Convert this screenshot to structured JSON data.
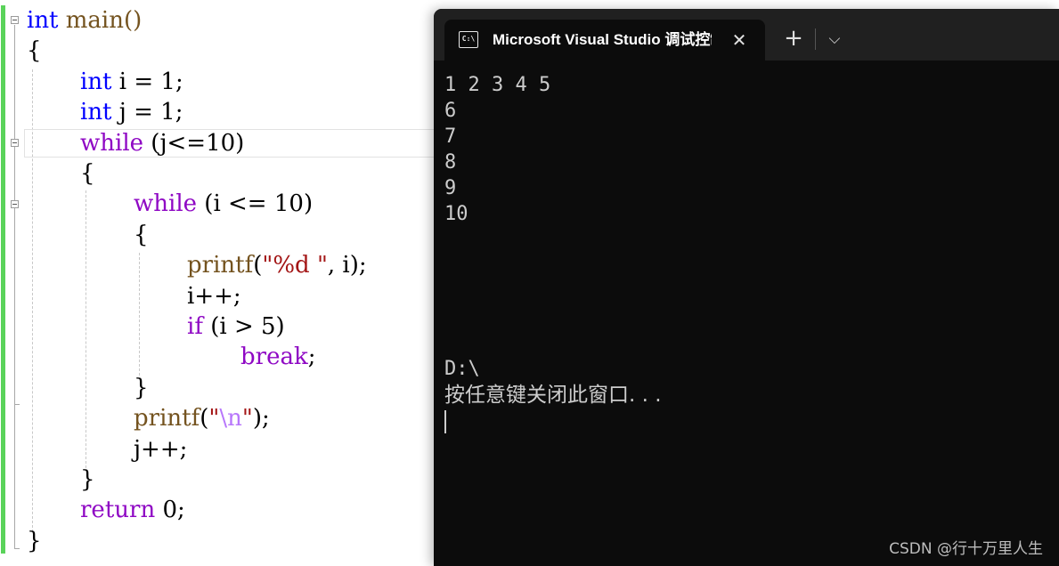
{
  "editor": {
    "lines": [
      {
        "indent": 0,
        "tokens": [
          {
            "t": "int",
            "c": "kw"
          },
          {
            "t": " main()",
            "c": "fn"
          }
        ]
      },
      {
        "indent": 0,
        "tokens": [
          {
            "t": "{",
            "c": ""
          }
        ]
      },
      {
        "indent": 1,
        "tokens": [
          {
            "t": "int",
            "c": "kw"
          },
          {
            "t": " i = 1;",
            "c": ""
          }
        ]
      },
      {
        "indent": 1,
        "tokens": [
          {
            "t": "int",
            "c": "kw"
          },
          {
            "t": " j = 1;",
            "c": ""
          }
        ]
      },
      {
        "indent": 1,
        "tokens": [
          {
            "t": "while",
            "c": "kw2"
          },
          {
            "t": " (j<=10)",
            "c": ""
          }
        ]
      },
      {
        "indent": 1,
        "tokens": [
          {
            "t": "{",
            "c": ""
          }
        ]
      },
      {
        "indent": 2,
        "tokens": [
          {
            "t": "while",
            "c": "kw2"
          },
          {
            "t": " (i <= 10)",
            "c": ""
          }
        ]
      },
      {
        "indent": 2,
        "tokens": [
          {
            "t": "{",
            "c": ""
          }
        ]
      },
      {
        "indent": 3,
        "tokens": [
          {
            "t": "printf",
            "c": "fn"
          },
          {
            "t": "(",
            "c": ""
          },
          {
            "t": "\"%d \"",
            "c": "str"
          },
          {
            "t": ", i);",
            "c": ""
          }
        ]
      },
      {
        "indent": 3,
        "tokens": [
          {
            "t": "i++;",
            "c": ""
          }
        ]
      },
      {
        "indent": 3,
        "tokens": [
          {
            "t": "if",
            "c": "kw2"
          },
          {
            "t": " (i > 5)",
            "c": ""
          }
        ]
      },
      {
        "indent": 4,
        "tokens": [
          {
            "t": "break",
            "c": "kw2"
          },
          {
            "t": ";",
            "c": ""
          }
        ]
      },
      {
        "indent": 2,
        "tokens": [
          {
            "t": "}",
            "c": ""
          }
        ]
      },
      {
        "indent": 2,
        "tokens": [
          {
            "t": "printf",
            "c": "fn"
          },
          {
            "t": "(",
            "c": ""
          },
          {
            "t": "\"",
            "c": "str"
          },
          {
            "t": "\\n",
            "c": "esc"
          },
          {
            "t": "\"",
            "c": "str"
          },
          {
            "t": ");",
            "c": ""
          }
        ]
      },
      {
        "indent": 2,
        "tokens": [
          {
            "t": "j++;",
            "c": ""
          }
        ]
      },
      {
        "indent": 1,
        "tokens": [
          {
            "t": "}",
            "c": ""
          }
        ]
      },
      {
        "indent": 1,
        "tokens": [
          {
            "t": "return",
            "c": "kw2"
          },
          {
            "t": " 0;",
            "c": ""
          }
        ]
      },
      {
        "indent": 0,
        "tokens": [
          {
            "t": "}",
            "c": ""
          }
        ]
      }
    ]
  },
  "console": {
    "tab_title": "Microsoft Visual Studio 调试控制台",
    "tab_icon_text": "C:\\",
    "close_glyph": "✕",
    "new_tab_glyph": "+",
    "dropdown_glyph": "⌵",
    "output_lines": [
      "1 2 3 4 5",
      "6",
      "7",
      "8",
      "9",
      "10"
    ],
    "path_line": "D:\\",
    "prompt": "按任意键关闭此窗口. . ."
  },
  "watermark": "CSDN @行十万里人生",
  "colors": {
    "keyword": "#0000ff",
    "control_keyword": "#8f08c4",
    "function": "#74531f",
    "string": "#a31515",
    "escape": "#b776fb",
    "console_bg": "#0c0c0c",
    "console_text": "#cccccc",
    "change_bar": "#5ad35a"
  }
}
